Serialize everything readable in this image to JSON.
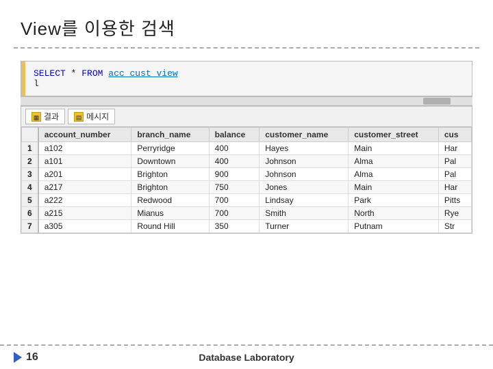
{
  "title": "View를 이용한 검색",
  "sql": {
    "line1_prefix": "SELECT * FROM ",
    "line1_view": "acc_cust_view",
    "line2": "l"
  },
  "tabs": [
    {
      "label": "결과",
      "icon": "grid"
    },
    {
      "label": "메시지",
      "icon": "doc"
    }
  ],
  "table": {
    "columns": [
      "account_number",
      "branch_name",
      "balance",
      "customer_name",
      "customer_street",
      "cus"
    ],
    "rows": [
      {
        "num": "1",
        "account_number": "a102",
        "branch_name": "Perryridge",
        "balance": "400",
        "customer_name": "Hayes",
        "customer_street": "Main",
        "cus": "Har"
      },
      {
        "num": "2",
        "account_number": "a101",
        "branch_name": "Downtown",
        "balance": "400",
        "customer_name": "Johnson",
        "customer_street": "Alma",
        "cus": "Pal"
      },
      {
        "num": "3",
        "account_number": "a201",
        "branch_name": "Brighton",
        "balance": "900",
        "customer_name": "Johnson",
        "customer_street": "Alma",
        "cus": "Pal"
      },
      {
        "num": "4",
        "account_number": "a217",
        "branch_name": "Brighton",
        "balance": "750",
        "customer_name": "Jones",
        "customer_street": "Main",
        "cus": "Har"
      },
      {
        "num": "5",
        "account_number": "a222",
        "branch_name": "Redwood",
        "balance": "700",
        "customer_name": "Lindsay",
        "customer_street": "Park",
        "cus": "Pitts"
      },
      {
        "num": "6",
        "account_number": "a215",
        "branch_name": "Mianus",
        "balance": "700",
        "customer_name": "Smith",
        "customer_street": "North",
        "cus": "Rye"
      },
      {
        "num": "7",
        "account_number": "a305",
        "branch_name": "Round Hill",
        "balance": "350",
        "customer_name": "Turner",
        "customer_street": "Putnam",
        "cus": "Str"
      }
    ]
  },
  "footer": {
    "page_num": "16",
    "center_text": "Database Laboratory"
  }
}
